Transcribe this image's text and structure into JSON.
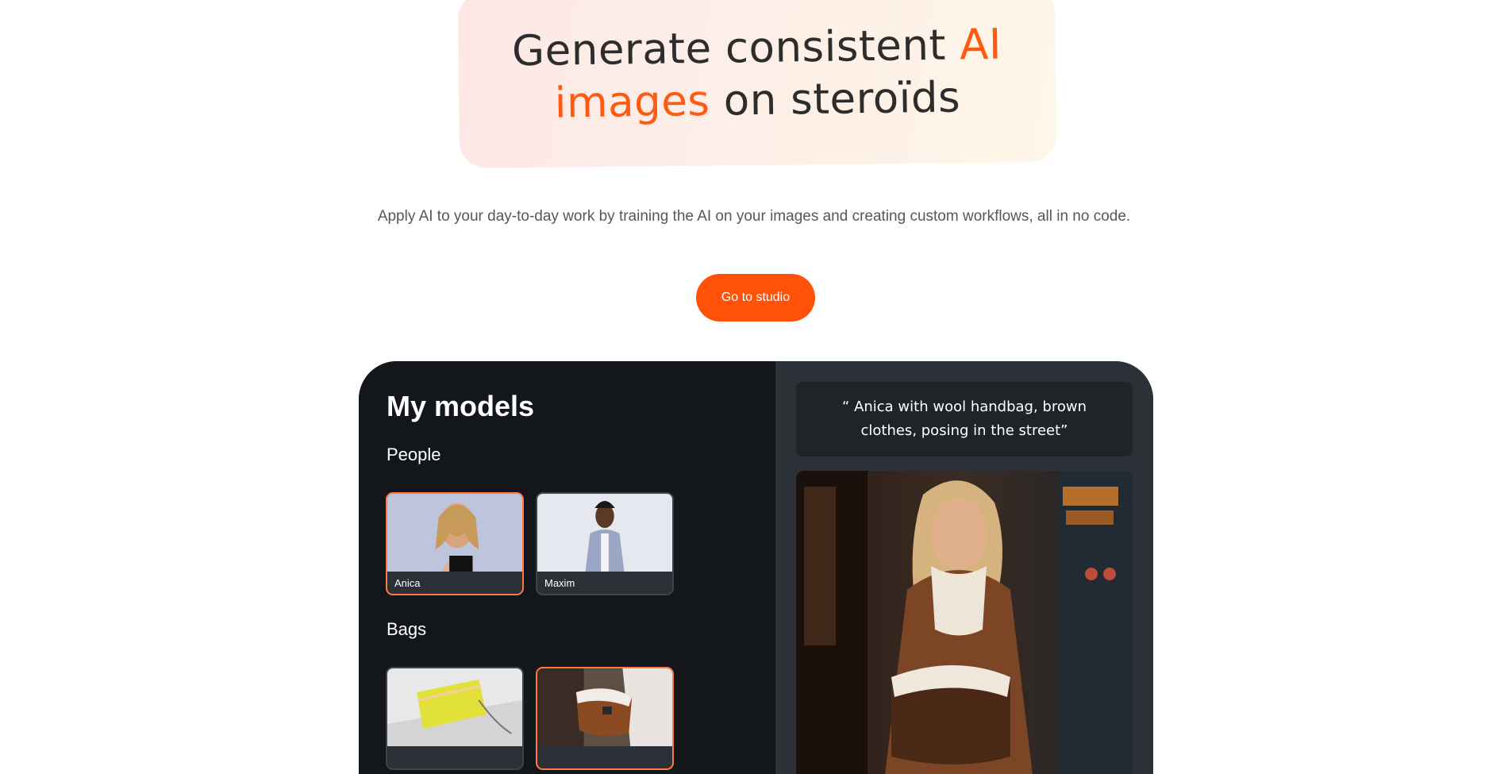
{
  "hero": {
    "title_part1": "Generate consistent ",
    "title_accent1": "AI",
    "title_accent2": "images",
    "title_part2": " on steroïds",
    "subtitle": "Apply AI to your day-to-day work by training the AI on your images and creating custom workflows, all in no code.",
    "cta_label": "Go to studio"
  },
  "demo": {
    "models_title": "My models",
    "sections": [
      {
        "label": "People",
        "items": [
          {
            "name": "Anica"
          },
          {
            "name": "Maxim"
          }
        ]
      },
      {
        "label": "Bags",
        "items": [
          {
            "name": ""
          },
          {
            "name": ""
          }
        ]
      }
    ],
    "prompt": "“ Anica with wool handbag, brown clothes, posing in the street”"
  },
  "colors": {
    "accent": "#ff5208",
    "panel_dark": "#13161a",
    "panel_right": "#2b3136"
  }
}
